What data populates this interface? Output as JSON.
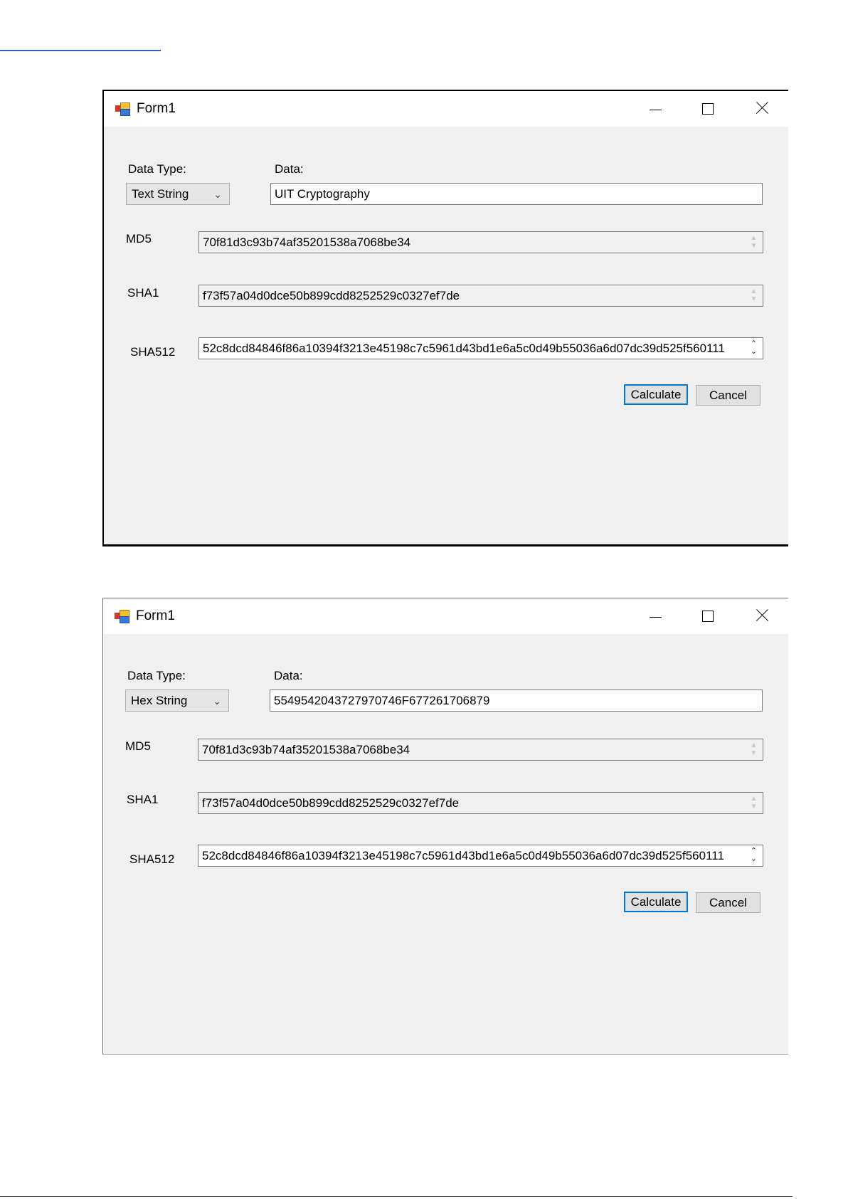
{
  "windows": [
    {
      "title": "Form1",
      "data_type_label": "Data Type:",
      "data_label": "Data:",
      "data_type_selected": "Text String",
      "data_value": "UIT Cryptography",
      "md5_label": "MD5",
      "md5_value": "70f81d3c93b74af35201538a7068be34",
      "sha1_label": "SHA1",
      "sha1_value": "f73f57a04d0dce50b899cdd8252529c0327ef7de",
      "sha512_label": "SHA512",
      "sha512_value": "52c8dcd84846f86a10394f3213e45198c7c5961d43bd1e6a5c0d49b55036a6d07dc39d525f560111",
      "calculate_label": "Calculate",
      "cancel_label": "Cancel"
    },
    {
      "title": "Form1",
      "data_type_label": "Data Type:",
      "data_label": "Data:",
      "data_type_selected": "Hex String",
      "data_value": "5549542043727970746F677261706879",
      "md5_label": "MD5",
      "md5_value": "70f81d3c93b74af35201538a7068be34",
      "sha1_label": "SHA1",
      "sha1_value": "f73f57a04d0dce50b899cdd8252529c0327ef7de",
      "sha512_label": "SHA512",
      "sha512_value": "52c8dcd84846f86a10394f3213e45198c7c5961d43bd1e6a5c0d49b55036a6d07dc39d525f560111",
      "calculate_label": "Calculate",
      "cancel_label": "Cancel"
    }
  ],
  "colors": {
    "window_background": "#f0f0f0",
    "titlebar": "#ffffff",
    "focus_accent": "#0078d7",
    "button_face": "#e1e1e1"
  },
  "icons": [
    "windows-form-icon",
    "minimize-icon",
    "maximize-icon",
    "close-icon",
    "chevron-down-icon",
    "spin-updown-icon"
  ]
}
